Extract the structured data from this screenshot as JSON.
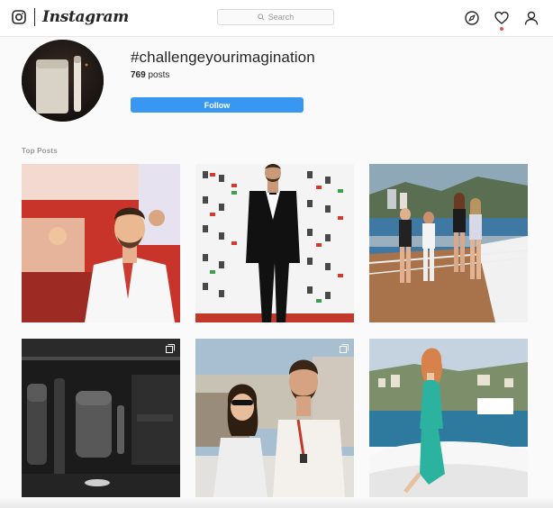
{
  "header": {
    "wordmark": "Instagram",
    "search_placeholder": "Search"
  },
  "hashtag": {
    "title": "#challengeyourimagination",
    "post_count": "769",
    "post_label": "posts",
    "follow_label": "Follow"
  },
  "sections": {
    "top_posts": "Top Posts"
  },
  "posts": [
    {
      "subject": "man in racing team shirt",
      "multi": false
    },
    {
      "subject": "man in tuxedo at event",
      "multi": false
    },
    {
      "subject": "women on yacht deck",
      "multi": false
    },
    {
      "subject": "device kit in case",
      "multi": true
    },
    {
      "subject": "couple selfie",
      "multi": true
    },
    {
      "subject": "woman on boat",
      "multi": false
    }
  ],
  "colors": {
    "accent": "#3897f0",
    "notification": "#ed4956",
    "text": "#262626",
    "muted": "#999999"
  }
}
